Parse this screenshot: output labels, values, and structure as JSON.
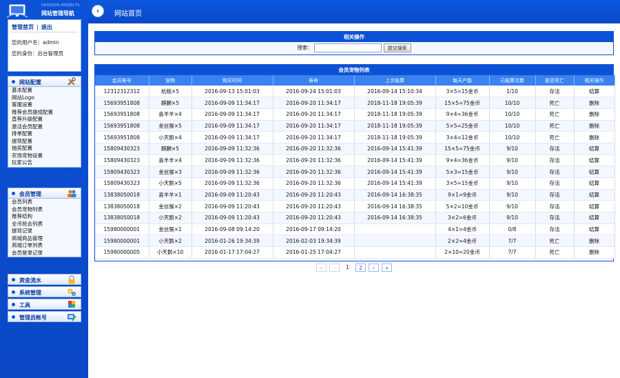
{
  "logo": {
    "subtitle": "DEHSSOR-PROJECTS",
    "title": "网站管理导航"
  },
  "user": {
    "home_link": "管理首页",
    "separator": "|",
    "logout_link": "退出",
    "username_label": "您的用户名：",
    "username": "admin",
    "role_label": "您的身份：",
    "role": "后台管理员"
  },
  "menus": [
    {
      "title": "网站配置",
      "icon": "tools-icon",
      "items": [
        "基本配置",
        "网站Logo",
        "客服设置",
        "推荐会员提成配置",
        "直荐升级配置",
        "激活会员配置",
        "排单配置",
        "提现配置",
        "抽奖配置",
        "农场宠物设置",
        "玩家公告"
      ]
    },
    {
      "title": "会员管理",
      "icon": "users-icon",
      "items": [
        "会员列表",
        "会员宠物列表",
        "推荐结构",
        "全币抢去列表",
        "提现记录",
        "商城商品管理",
        "商城订单列表",
        "会员登录记录"
      ]
    },
    {
      "title": "资金流水",
      "icon": "lock-icon",
      "items": []
    },
    {
      "title": "系统管理",
      "icon": "gears-icon",
      "items": []
    },
    {
      "title": "工具",
      "icon": "puzzle-icon",
      "items": []
    },
    {
      "title": "管理员帐号",
      "icon": "admin-icon",
      "items": []
    }
  ],
  "header": {
    "back_icon": "back-arrow-icon",
    "title": "网站首页"
  },
  "search": {
    "title": "相关操作",
    "label": "搜索：",
    "value": "",
    "placeholder": "",
    "button": "提交搜索"
  },
  "list": {
    "title": "会员宠物列表",
    "columns": [
      "会员帐号",
      "宠物",
      "购买时间",
      "寿命",
      "上次结算",
      "每天产能",
      "已结算次数",
      "是否死亡",
      "相关操作"
    ],
    "rows": [
      [
        "12312312312",
        "杭桃×5",
        "2016-09-13 15:01:03",
        "2016-09-24 15:01:03",
        "2016-09-14 15:10:34",
        "3×5=15金币",
        "1/10",
        "存活",
        "结算"
      ],
      [
        "15693951808",
        "麒麟×5",
        "2016-09-09 11:34:17",
        "2016-09-20 11:34:17",
        "2018-11-18 19:05:39",
        "15×5=75金币",
        "10/10",
        "死亡",
        "删除"
      ],
      [
        "15693951808",
        "喜羊羊×4",
        "2016-09-09 11:34:17",
        "2016-09-20 11:34:17",
        "2018-11-18 19:05:39",
        "9×4=36金币",
        "10/10",
        "死亡",
        "删除"
      ],
      [
        "15693951808",
        "金丝猴×5",
        "2016-09-09 11:34:17",
        "2016-09-20 11:34:17",
        "2018-11-18 19:05:39",
        "5×5=25金币",
        "10/10",
        "死亡",
        "删除"
      ],
      [
        "15693951808",
        "小天鹅×4",
        "2016-09-09 11:34:17",
        "2016-09-20 11:34:17",
        "2018-11-18 19:05:39",
        "3×4=12金币",
        "10/10",
        "死亡",
        "删除"
      ],
      [
        "15809430323",
        "麒麟×5",
        "2016-09-09 11:32:36",
        "2016-09-20 11:32:36",
        "2016-09-14 15:41:39",
        "15×5=75金币",
        "9/10",
        "存活",
        "结算"
      ],
      [
        "15809430323",
        "喜羊羊×4",
        "2016-09-09 11:32:36",
        "2016-09-20 11:32:36",
        "2016-09-14 15:41:39",
        "9×4=36金币",
        "9/10",
        "存活",
        "结算"
      ],
      [
        "15809430323",
        "金丝猴×3",
        "2016-09-09 11:32:36",
        "2016-09-20 11:32:36",
        "2016-09-14 15:41:39",
        "5×3=15金币",
        "9/10",
        "存活",
        "结算"
      ],
      [
        "15809430323",
        "小天鹅×5",
        "2016-09-09 11:32:36",
        "2016-09-20 11:32:36",
        "2016-09-14 15:41:39",
        "3×5=15金币",
        "9/10",
        "存活",
        "结算"
      ],
      [
        "13838050018",
        "喜羊羊×1",
        "2016-09-09 11:20:43",
        "2016-09-20 11:20:43",
        "2016-09-14 16:38:35",
        "9×1=9金币",
        "9/10",
        "存活",
        "结算"
      ],
      [
        "13838050018",
        "金丝猴×2",
        "2016-09-09 11:20:43",
        "2016-09-20 11:20:43",
        "2016-09-14 16:38:35",
        "5×2=10金币",
        "9/10",
        "存活",
        "结算"
      ],
      [
        "13838050018",
        "小天鹅×2",
        "2016-09-09 11:20:43",
        "2016-09-20 11:20:43",
        "2016-09-14 16:38:35",
        "3×2=6金币",
        "9/10",
        "存活",
        "结算"
      ],
      [
        "15980000001",
        "金丝猴×1",
        "2016-09-08 09:14:20",
        "2016-09-17 09:14:20",
        "",
        "4×1=4金币",
        "0/8",
        "存活",
        "结算"
      ],
      [
        "15980000001",
        "小天鹅×2",
        "2016-01-26 19:34:39",
        "2016-02-03 19:34:39",
        "",
        "2×2=4金币",
        "7/7",
        "死亡",
        "删除"
      ],
      [
        "15980000005",
        "小天鹅×10",
        "2016-01-17 17:04:27",
        "2016-01-25 17:04:27",
        "",
        "2×10=20金币",
        "7/7",
        "死亡",
        "删除"
      ]
    ]
  },
  "pager": {
    "first": "«",
    "prev": "‹",
    "pages": [
      "1",
      "2"
    ],
    "current": "1",
    "next": "›",
    "last": "»"
  },
  "colors": {
    "brand_blue": "#0a4fd2",
    "header_blue": "#3a82f0"
  }
}
